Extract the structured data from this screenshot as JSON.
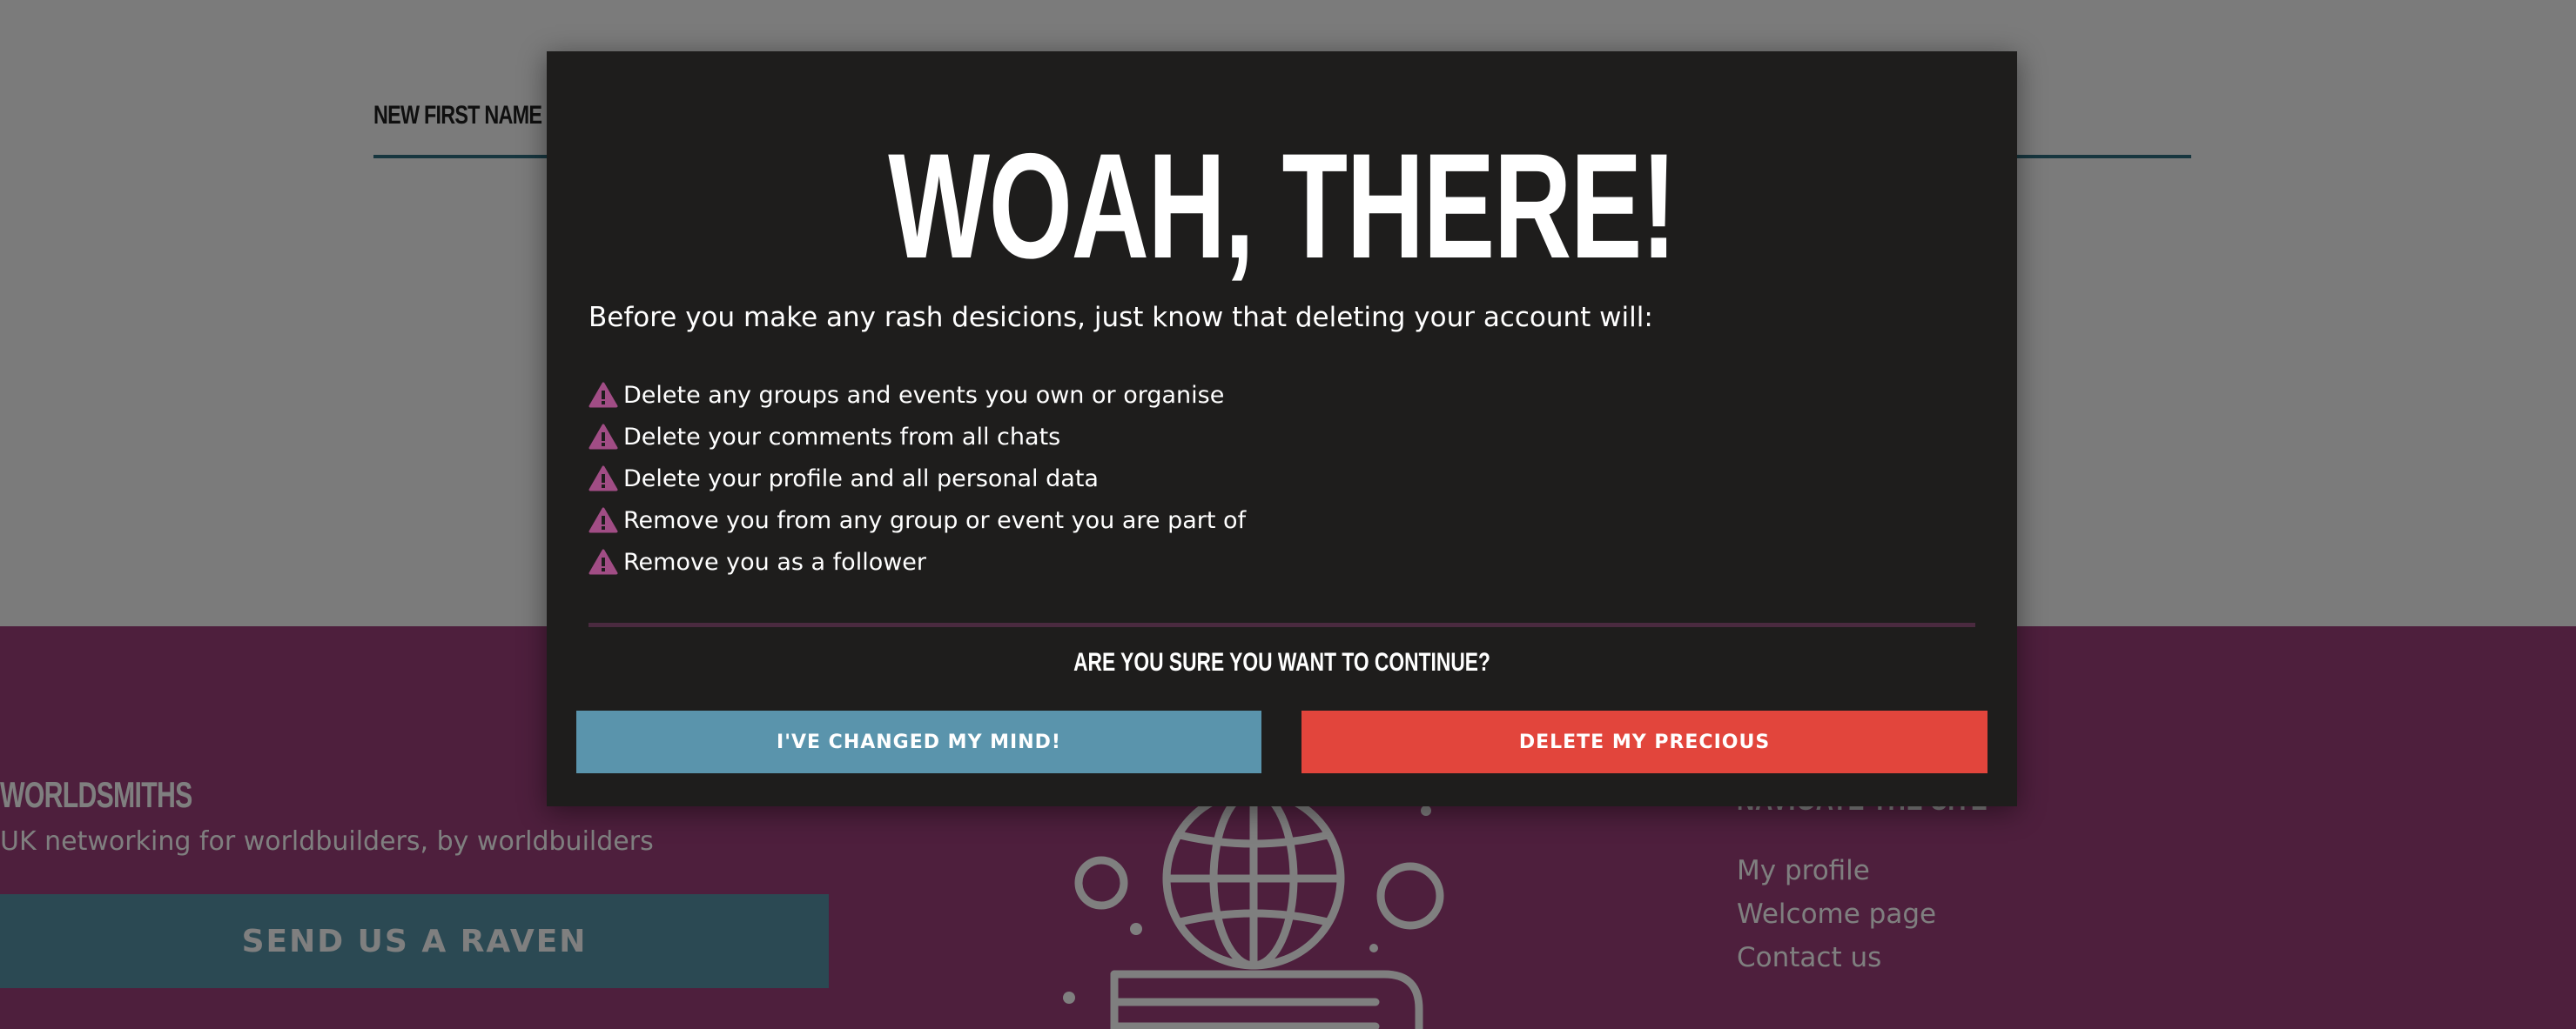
{
  "form": {
    "field_label": "NEW FIRST NAME"
  },
  "footer": {
    "brand_name": "WORLDSMITHS",
    "tagline": "UK networking for worldbuilders, by worldbuilders",
    "raven_button_label": "SEND US A RAVEN",
    "nav_heading": "NAVIGATE THE SITE",
    "links": [
      "My profile",
      "Welcome page",
      "Contact us"
    ]
  },
  "modal": {
    "title": "WOAH, THERE!",
    "intro": "Before you make any rash desicions, just know that deleting your account will:",
    "warnings": [
      "Delete any groups and events you own or organise",
      "Delete your comments from all chats",
      "Delete your profile and all personal data",
      "Remove you from any group or event you are part of",
      "Remove you as a follower"
    ],
    "question": "ARE YOU SURE YOU WANT TO CONTINUE?",
    "cancel_label": "I'VE CHANGED MY MIND!",
    "delete_label": "DELETE MY PRECIOUS"
  },
  "colors": {
    "footer_bg": "#9c3f7b",
    "modal_bg": "#1e1d1c",
    "cancel_button": "#5a94ac",
    "delete_button": "#e2453c",
    "warning_icon": "#a14d85",
    "field_underline": "#2e6c7e"
  },
  "icons": {
    "warning": "warning-triangle-icon",
    "illustration": "globe-book-icon"
  }
}
